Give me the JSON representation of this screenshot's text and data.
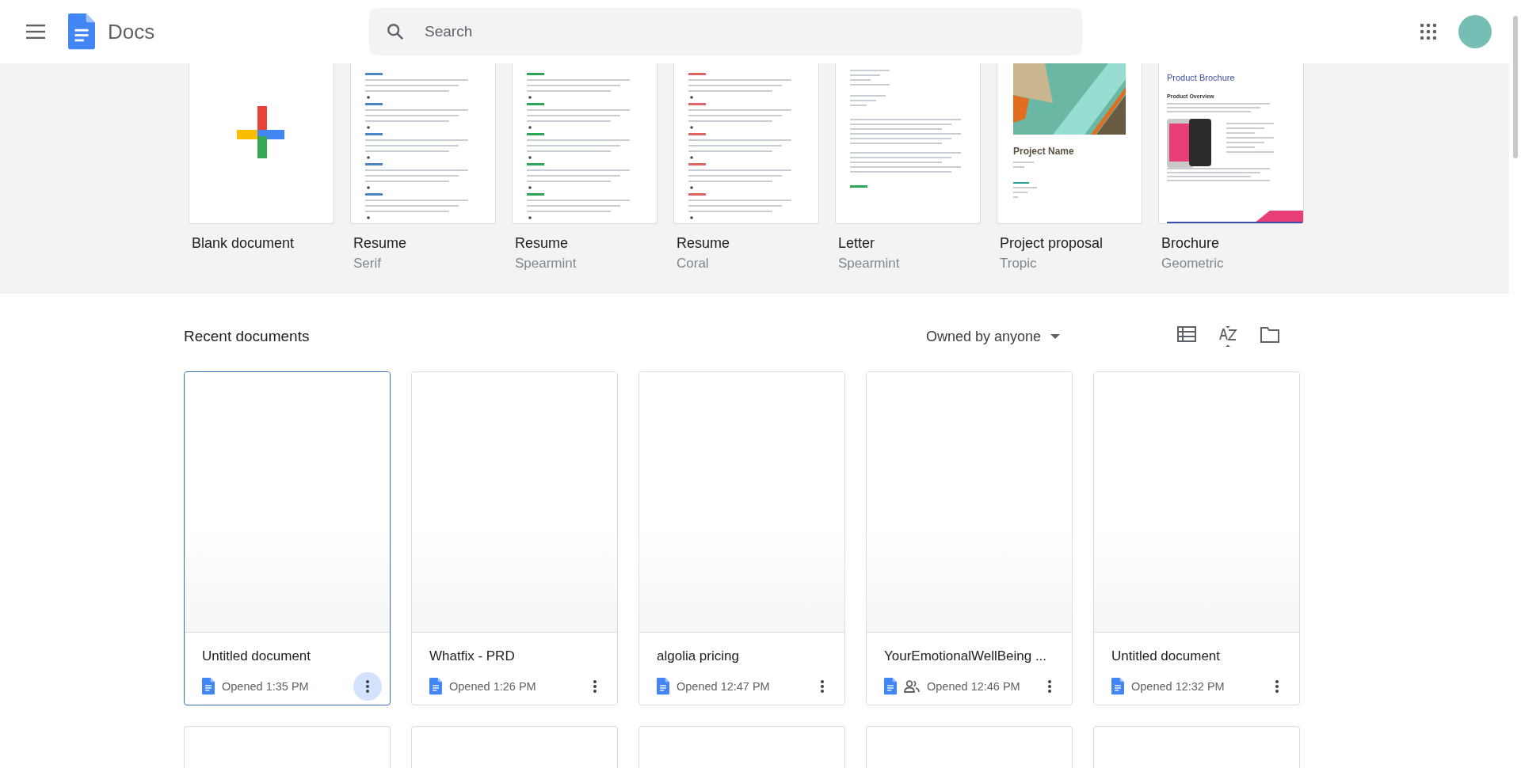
{
  "header": {
    "app_name": "Docs",
    "search": {
      "placeholder": "Search"
    }
  },
  "templates": [
    {
      "kind": "blank",
      "name": "Blank document"
    },
    {
      "kind": "resume",
      "name": "Resume",
      "style": "Serif"
    },
    {
      "kind": "resume",
      "name": "Resume",
      "style": "Spearmint"
    },
    {
      "kind": "resume",
      "name": "Resume",
      "style": "Coral"
    },
    {
      "kind": "letter",
      "name": "Letter",
      "style": "Spearmint"
    },
    {
      "kind": "proposal",
      "name": "Project proposal",
      "style": "Tropic",
      "heading": "Project Name"
    },
    {
      "kind": "brochure",
      "name": "Brochure",
      "style": "Geometric",
      "heading": "Product Brochure",
      "subheading": "Product Overview"
    }
  ],
  "recent": {
    "title": "Recent documents",
    "owner_filter": "Owned by anyone",
    "documents": [
      {
        "title": "Untitled document",
        "opened": "Opened 1:35 PM",
        "shared": false,
        "selected": true
      },
      {
        "title": "Whatfix - PRD",
        "opened": "Opened 1:26 PM",
        "shared": false,
        "selected": false
      },
      {
        "title": "algolia pricing",
        "opened": "Opened 12:47 PM",
        "shared": false,
        "selected": false
      },
      {
        "title": "YourEmotionalWellBeing ...",
        "opened": "Opened 12:46 PM",
        "shared": true,
        "selected": false
      },
      {
        "title": "Untitled document",
        "opened": "Opened 12:32 PM",
        "shared": false,
        "selected": false
      }
    ]
  }
}
